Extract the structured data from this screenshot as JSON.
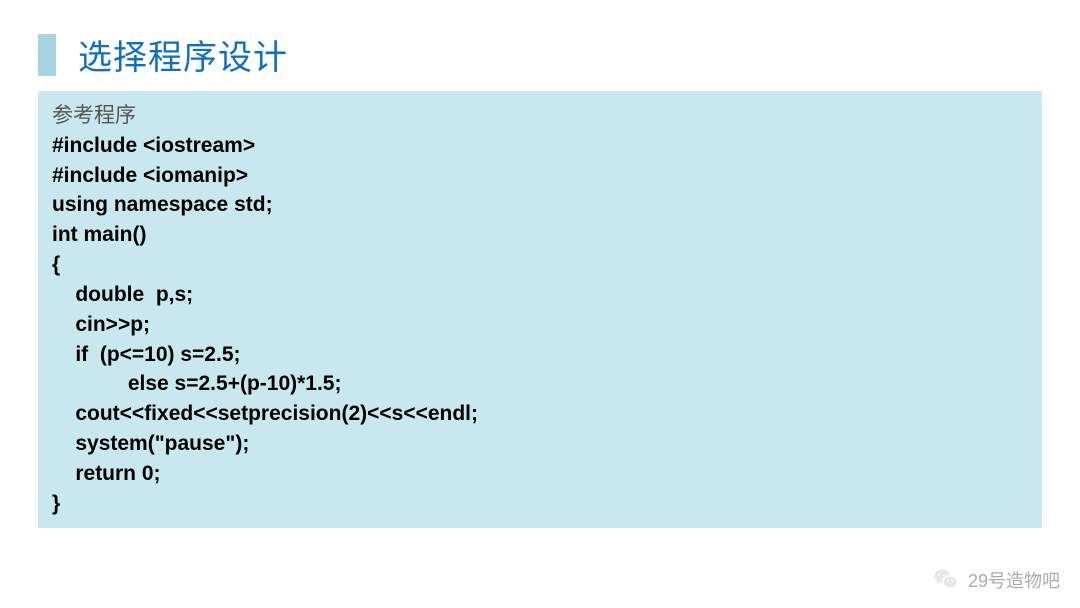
{
  "title": "选择程序设计",
  "reference_label": "参考程序",
  "code_lines": [
    "#include <iostream>",
    "#include <iomanip>",
    "using namespace std;",
    "int main()",
    "{",
    "    double  p,s;",
    "    cin>>p;",
    "    if  (p<=10) s=2.5;",
    "             else s=2.5+(p-10)*1.5;",
    "    cout<<fixed<<setprecision(2)<<s<<endl;",
    "    system(\"pause\");",
    "    return 0;",
    "}"
  ],
  "watermark_text": "29号造物吧",
  "colors": {
    "title_color": "#0f6fc6",
    "accent_bar": "#a7d3e0",
    "code_bg": "#c9e7ef"
  }
}
